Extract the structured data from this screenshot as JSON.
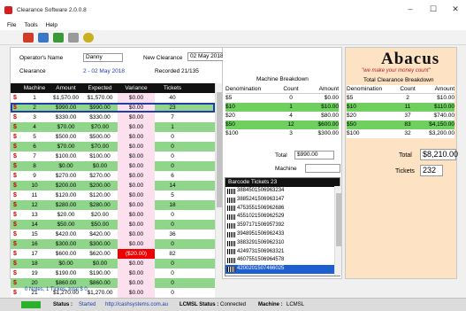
{
  "window": {
    "title": "Clearance Software 2.0.0.8",
    "minimize": "–",
    "maximize": "☐",
    "close": "✕"
  },
  "menu": [
    "File",
    "Tools",
    "Help"
  ],
  "toolbar_icons": [
    "new-icon",
    "list-icon",
    "print-icon",
    "delete-icon",
    "clock-icon"
  ],
  "operator": {
    "label": "Operator's Name",
    "value": "Danny"
  },
  "new_clearance": {
    "label": "New Clearance",
    "date": "02 May 2018"
  },
  "clearance": {
    "label": "Clearance",
    "value": "2  -  02 May 2018",
    "recorded": "Recorded 21/135"
  },
  "grid": {
    "headers": [
      "Machine No",
      "Amount",
      "Expected",
      "Variance",
      "Tickets"
    ],
    "rows": [
      [
        "1",
        "$1,570.00",
        "$1,570.00",
        "$0.00",
        "40"
      ],
      [
        "2",
        "$990.00",
        "$990.00",
        "$0.00",
        "23"
      ],
      [
        "3",
        "$330.00",
        "$330.00",
        "$0.00",
        "7"
      ],
      [
        "4",
        "$70.00",
        "$70.00",
        "$0.00",
        "1"
      ],
      [
        "5",
        "$500.00",
        "$500.00",
        "$0.00",
        "0"
      ],
      [
        "6",
        "$70.00",
        "$70.00",
        "$0.00",
        "0"
      ],
      [
        "7",
        "$100.00",
        "$100.00",
        "$0.00",
        "0"
      ],
      [
        "8",
        "$0.00",
        "$0.00",
        "$0.00",
        "0"
      ],
      [
        "9",
        "$270.00",
        "$270.00",
        "$0.00",
        "6"
      ],
      [
        "10",
        "$200.00",
        "$200.00",
        "$0.00",
        "14"
      ],
      [
        "11",
        "$120.00",
        "$120.00",
        "$0.00",
        "5"
      ],
      [
        "12",
        "$280.00",
        "$280.00",
        "$0.00",
        "18"
      ],
      [
        "13",
        "$20.00",
        "$20.00",
        "$0.00",
        "0"
      ],
      [
        "14",
        "$50.00",
        "$50.00",
        "$0.00",
        "0"
      ],
      [
        "15",
        "$420.00",
        "$420.00",
        "$0.00",
        "36"
      ],
      [
        "16",
        "$300.00",
        "$300.00",
        "$0.00",
        "0"
      ],
      [
        "17",
        "$600.00",
        "$620.00",
        "($20.00)",
        "82"
      ],
      [
        "18",
        "$0.00",
        "$0.00",
        "$0.00",
        "0"
      ],
      [
        "19",
        "$190.00",
        "$190.00",
        "$0.00",
        "0"
      ],
      [
        "20",
        "$860.00",
        "$860.00",
        "$0.00",
        "0"
      ],
      [
        "21",
        "$1,270.00",
        "$1,270.00",
        "$0.00",
        "0"
      ]
    ]
  },
  "machine_breakdown": {
    "title": "Machine Breakdown",
    "headers": [
      "Denomination",
      "Count",
      "Amount"
    ],
    "rows": [
      [
        "$5",
        "0",
        "$0.00"
      ],
      [
        "$10",
        "1",
        "$10.00"
      ],
      [
        "$20",
        "4",
        "$80.00"
      ],
      [
        "$50",
        "12",
        "$600.00"
      ],
      [
        "$100",
        "3",
        "$300.00"
      ]
    ],
    "total_label": "Total",
    "total_value": "$990.00",
    "machine_label": "Machine",
    "machine_value": ""
  },
  "barcodes": {
    "title": "Barcode Tickets 23",
    "items": [
      "3884501506963234",
      "3885241506963147",
      "4753551506962686",
      "4551021506962529",
      "3597171506957392",
      "3948951506962433",
      "3883291506962310",
      "4249731506963321",
      "4607551506964578",
      "4200201507466025"
    ]
  },
  "abacus": {
    "logo": "Abacus",
    "tagline": "\"we make your money count\""
  },
  "total_breakdown": {
    "title": "Total Clearance Breakdown",
    "headers": [
      "Denomination",
      "Count",
      "Amount"
    ],
    "rows": [
      [
        "$5",
        "2",
        "$10.00"
      ],
      [
        "$10",
        "11",
        "$110.00"
      ],
      [
        "$20",
        "37",
        "$740.00"
      ],
      [
        "$50",
        "83",
        "$4,150.00"
      ],
      [
        "$100",
        "32",
        "$3,200.00"
      ]
    ],
    "total_label": "Total",
    "total_value": "$8,210.00",
    "tickets_label": "Tickets",
    "tickets_value": "232"
  },
  "notes": "0 Notes, 1 Tickes, total $ 0",
  "status": {
    "status_label": "Status :",
    "status_value": "Started",
    "url": "http://cashsystems.com.au",
    "lcmsl_label": "LCMSL Status :",
    "lcmsl_value": "Connected",
    "machine_label": "Machine :",
    "machine_value": "LCMSL"
  },
  "colors": {
    "green_row": "#8fd68a",
    "negative": "#e00000",
    "selection": "#1f3ea8",
    "accent_panel": "#fde3c3"
  }
}
